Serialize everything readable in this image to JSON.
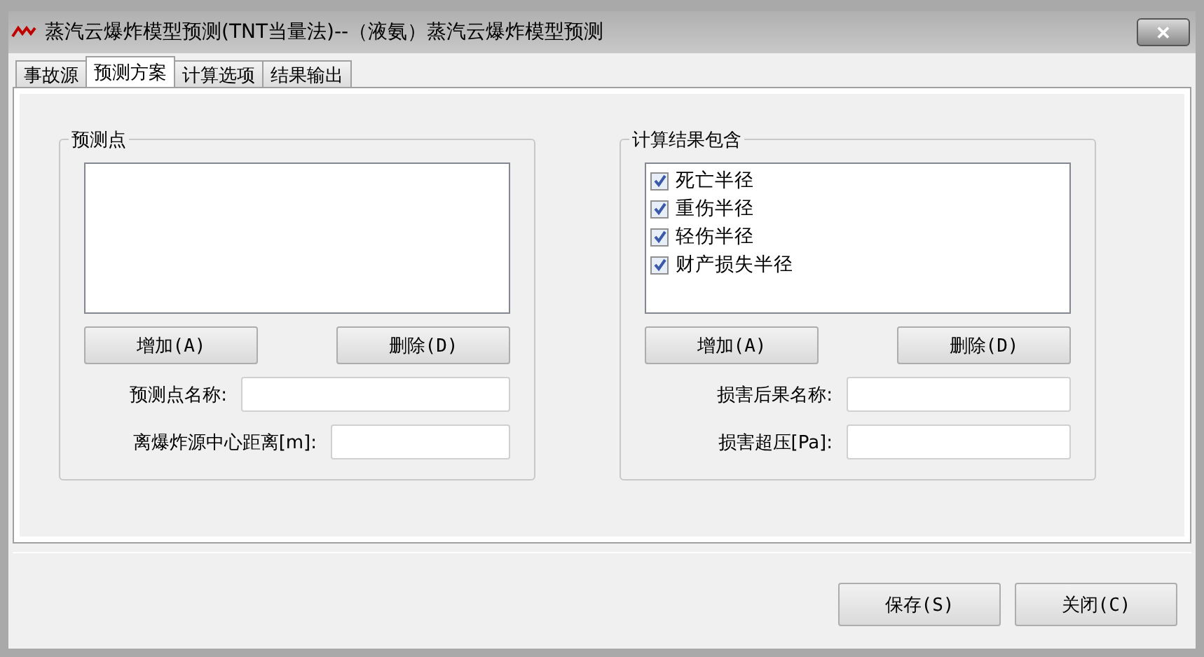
{
  "window": {
    "title": "蒸汽云爆炸模型预测(TNT当量法)--（液氨）蒸汽云爆炸模型预测",
    "close": "✕"
  },
  "tabs": [
    {
      "label": "事故源",
      "selected": false
    },
    {
      "label": "预测方案",
      "selected": true
    },
    {
      "label": "计算选项",
      "selected": false
    },
    {
      "label": "结果输出",
      "selected": false
    }
  ],
  "groups": [
    {
      "title": "预测点",
      "buttons": [
        "增加(A)",
        "删除(D)"
      ],
      "fields": [
        {
          "label": "预测点名称:"
        },
        {
          "label": "离爆炸源中心距离[m]:"
        }
      ]
    },
    {
      "title": "计算结果包含",
      "items": [
        {
          "label": "死亡半径",
          "checked": true
        },
        {
          "label": "重伤半径",
          "checked": true
        },
        {
          "label": "轻伤半径",
          "checked": true
        },
        {
          "label": "财产损失半径",
          "checked": true
        }
      ],
      "buttons": [
        "增加(A)",
        "删除(D)"
      ],
      "fields": [
        {
          "label": "损害后果名称:"
        },
        {
          "label": "损害超压[Pa]:"
        }
      ]
    }
  ],
  "buttons": [
    "保存(S)",
    "关闭(C)"
  ]
}
